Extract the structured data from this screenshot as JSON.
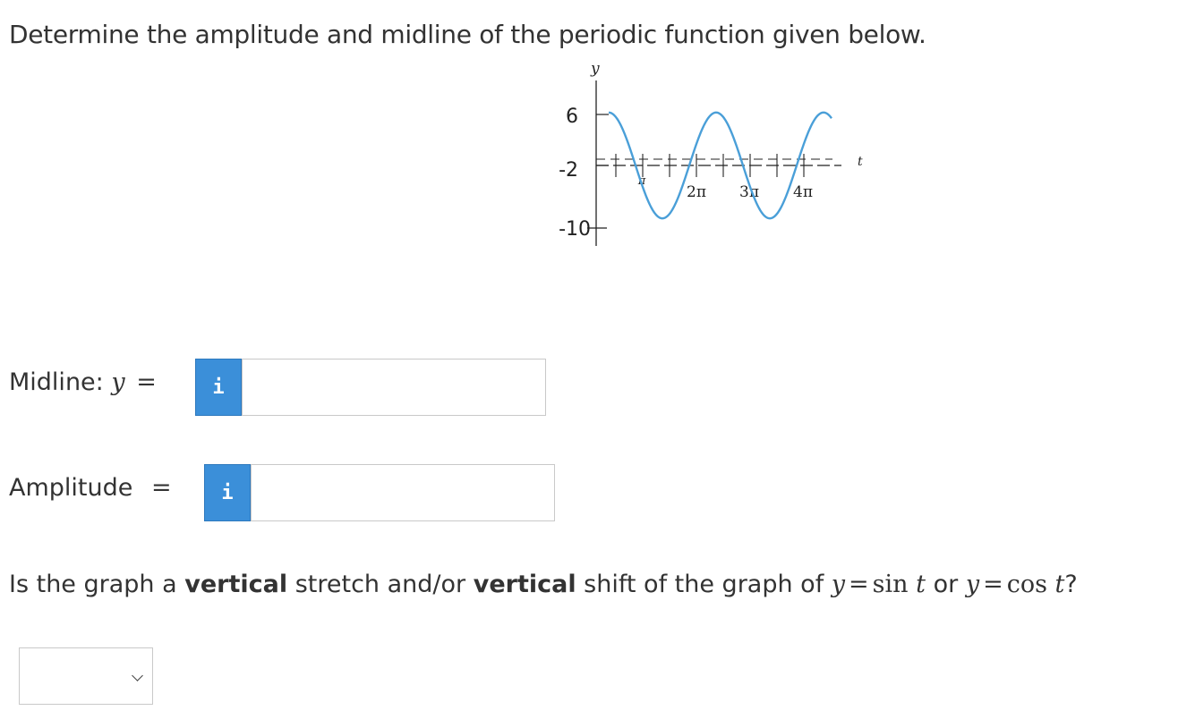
{
  "question": {
    "text": "Determine the amplitude and midline of the periodic function given below."
  },
  "graph": {
    "y_axis_label": "y",
    "x_axis_label": "t",
    "y_ticks": [
      "6",
      "-2",
      "-10"
    ],
    "x_ticks": [
      "π",
      "2π",
      "3π",
      "4π"
    ],
    "curve_color": "#4a9fd8",
    "function": {
      "amplitude": 8,
      "midline": -2,
      "period_in_pi": 2
    }
  },
  "midline": {
    "label": "Midline:",
    "var": "y",
    "op": "=",
    "info_icon": "i",
    "value": ""
  },
  "amplitude": {
    "label": "Amplitude",
    "op": "=",
    "info_icon": "i",
    "value": ""
  },
  "question2": {
    "part1": "Is the graph a ",
    "bold1": "vertical",
    "part2": " stretch and/or ",
    "bold2": "vertical",
    "part3": " shift of the graph of ",
    "var1": "y",
    "op1": "=",
    "fn1": "sin",
    "arg1": "t",
    "or": " or ",
    "var2": "y",
    "op2": "=",
    "fn2": "cos",
    "arg2": "t",
    "qmark": "?"
  },
  "select": {
    "selected": ""
  },
  "colors": {
    "info_button": "#3b8fd9",
    "curve": "#4a9fd8",
    "text": "#333333"
  }
}
